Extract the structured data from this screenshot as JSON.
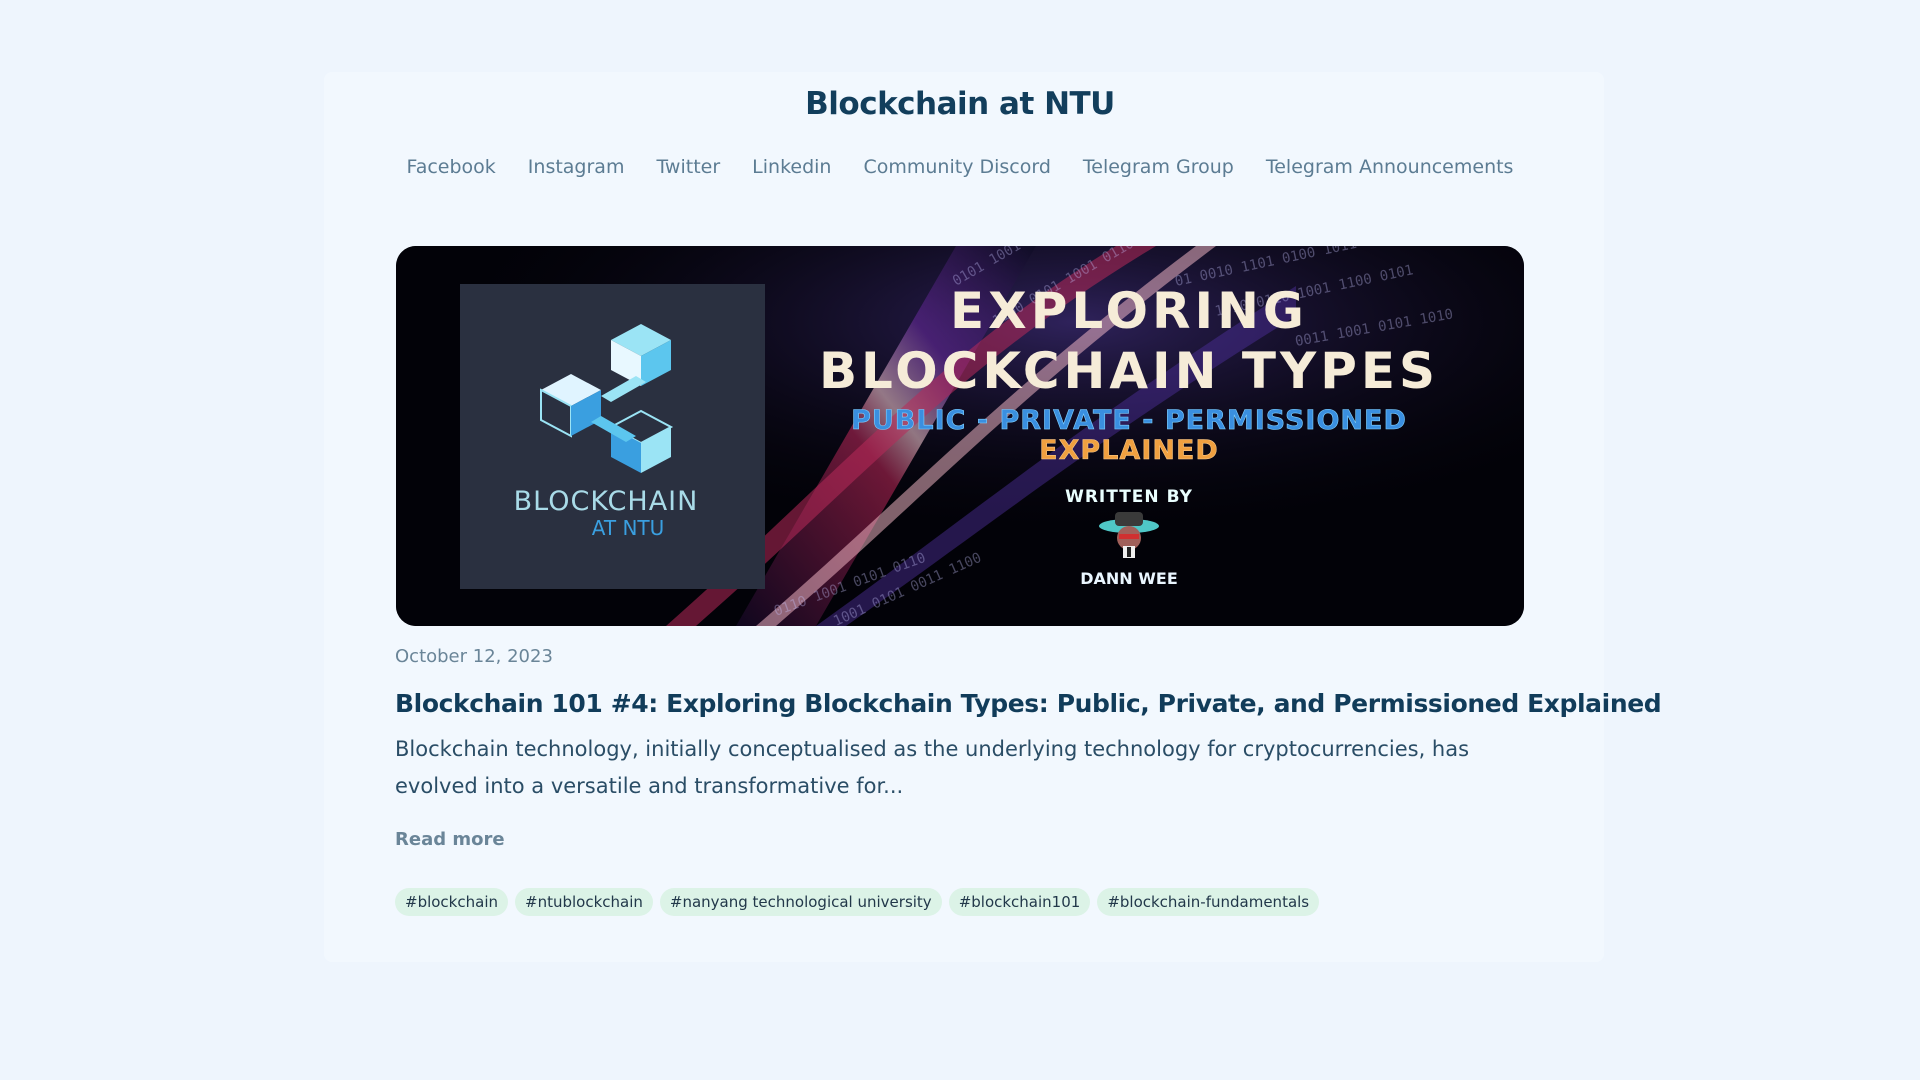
{
  "site": {
    "title": "Blockchain at NTU"
  },
  "nav": {
    "items": [
      {
        "label": "Facebook"
      },
      {
        "label": "Instagram"
      },
      {
        "label": "Twitter"
      },
      {
        "label": "Linkedin"
      },
      {
        "label": "Community Discord"
      },
      {
        "label": "Telegram Group"
      },
      {
        "label": "Telegram Announcements"
      }
    ]
  },
  "banner": {
    "logo_line1": "BLOCKCHAIN",
    "logo_line2": "AT NTU",
    "headline1": "EXPLORING",
    "headline2": "BLOCKCHAIN TYPES",
    "subline": "PUBLIC - PRIVATE - PERMISSIONED",
    "subline2": "EXPLAINED",
    "written_by": "WRITTEN BY",
    "author": "DANN WEE",
    "colors": {
      "logo_bg": "#2a3040",
      "cube_light": "#9be4f5",
      "cube_dark": "#3a9fe0",
      "subline": "#3a8fe0",
      "explained": "#f0a040"
    }
  },
  "post": {
    "date": "October 12, 2023",
    "title": "Blockchain 101 #4: Exploring Blockchain Types: Public, Private, and Permissioned Explained",
    "excerpt": "Blockchain technology, initially conceptualised as the underlying technology for cryptocurrencies, has evolved into a versatile and transformative for...",
    "read_more": "Read more",
    "tags": [
      "#blockchain",
      "#ntublockchain",
      "#nanyang technological university",
      "#blockchain101",
      "#blockchain-fundamentals"
    ]
  }
}
